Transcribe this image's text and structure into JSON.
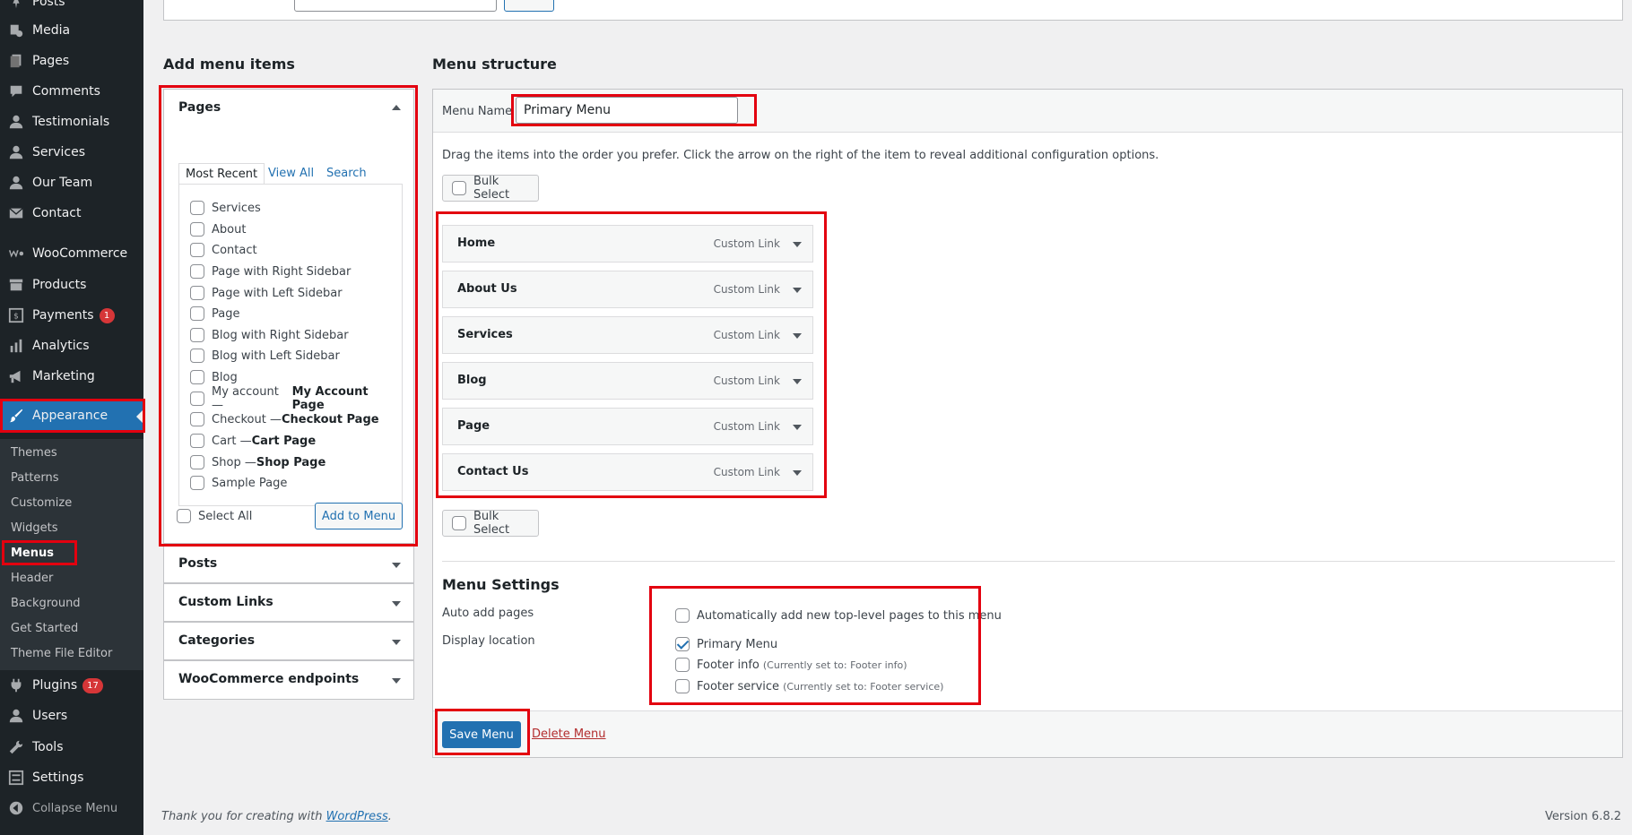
{
  "sidebar": {
    "items": [
      {
        "label": "Posts",
        "icon": "pin-icon"
      },
      {
        "label": "Media",
        "icon": "media-icon"
      },
      {
        "label": "Pages",
        "icon": "pages-icon"
      },
      {
        "label": "Comments",
        "icon": "comments-icon"
      },
      {
        "label": "Testimonials",
        "icon": "person-icon"
      },
      {
        "label": "Services",
        "icon": "person-icon"
      },
      {
        "label": "Our Team",
        "icon": "person-icon"
      },
      {
        "label": "Contact",
        "icon": "mail-icon"
      },
      {
        "label": "WooCommerce",
        "icon": "woo-icon"
      },
      {
        "label": "Products",
        "icon": "archive-icon"
      },
      {
        "label": "Payments",
        "icon": "payments-icon",
        "badge": "1"
      },
      {
        "label": "Analytics",
        "icon": "bar-chart-icon"
      },
      {
        "label": "Marketing",
        "icon": "megaphone-icon"
      },
      {
        "label": "Appearance",
        "icon": "brush-icon"
      },
      {
        "label": "Plugins",
        "icon": "plug-icon",
        "badge": "17"
      },
      {
        "label": "Users",
        "icon": "user-icon"
      },
      {
        "label": "Tools",
        "icon": "wrench-icon"
      },
      {
        "label": "Settings",
        "icon": "settings-icon"
      },
      {
        "label": "Collapse Menu",
        "icon": "collapse-icon"
      }
    ],
    "appearance_sub": [
      "Themes",
      "Patterns",
      "Customize",
      "Widgets",
      "Menus",
      "Header",
      "Background",
      "Get Started",
      "Theme File Editor"
    ]
  },
  "add_items": {
    "heading": "Add menu items",
    "pages_title": "Pages",
    "tabs": [
      "Most Recent",
      "View All",
      "Search"
    ],
    "pages": [
      {
        "text": "Services"
      },
      {
        "text": "About"
      },
      {
        "text": "Contact"
      },
      {
        "text": "Page with Right Sidebar"
      },
      {
        "text": "Page with Left Sidebar"
      },
      {
        "text": "Page"
      },
      {
        "text": "Blog with Right Sidebar"
      },
      {
        "text": "Blog with Left Sidebar"
      },
      {
        "text": "Blog"
      },
      {
        "text": "My account — ",
        "bold": "My Account Page"
      },
      {
        "text": "Checkout — ",
        "bold": "Checkout Page"
      },
      {
        "text": "Cart — ",
        "bold": "Cart Page"
      },
      {
        "text": "Shop — ",
        "bold": "Shop Page"
      },
      {
        "text": "Sample Page"
      }
    ],
    "select_all": "Select All",
    "add_button": "Add to Menu",
    "other_sections": [
      "Posts",
      "Custom Links",
      "Categories",
      "WooCommerce endpoints"
    ]
  },
  "structure": {
    "heading": "Menu structure",
    "menu_name_label": "Menu Name",
    "menu_name_value": "Primary Menu",
    "help": "Drag the items into the order you prefer. Click the arrow on the right of the item to reveal additional configuration options.",
    "bulk_select": "Bulk Select",
    "items": [
      {
        "title": "Home",
        "type": "Custom Link"
      },
      {
        "title": "About Us",
        "type": "Custom Link"
      },
      {
        "title": "Services",
        "type": "Custom Link"
      },
      {
        "title": "Blog",
        "type": "Custom Link"
      },
      {
        "title": "Page",
        "type": "Custom Link"
      },
      {
        "title": "Contact Us",
        "type": "Custom Link"
      }
    ]
  },
  "settings": {
    "title": "Menu Settings",
    "auto_add_label": "Auto add pages",
    "auto_add_option": "Automatically add new top-level pages to this menu",
    "display_location_label": "Display location",
    "locations": [
      {
        "label": "Primary Menu",
        "note": "",
        "checked": true
      },
      {
        "label": "Footer info",
        "note": "(Currently set to: Footer info)",
        "checked": false
      },
      {
        "label": "Footer service",
        "note": "(Currently set to: Footer service)",
        "checked": false
      }
    ],
    "save": "Save Menu",
    "delete": "Delete Menu"
  },
  "footer": {
    "thanks_prefix": "Thank you for creating with ",
    "thanks_link": "WordPress",
    "thanks_suffix": ".",
    "version": "Version 6.8.2"
  },
  "colors": {
    "accent": "#2271b1",
    "highlight": "#e3000f",
    "badge": "#d63638"
  }
}
